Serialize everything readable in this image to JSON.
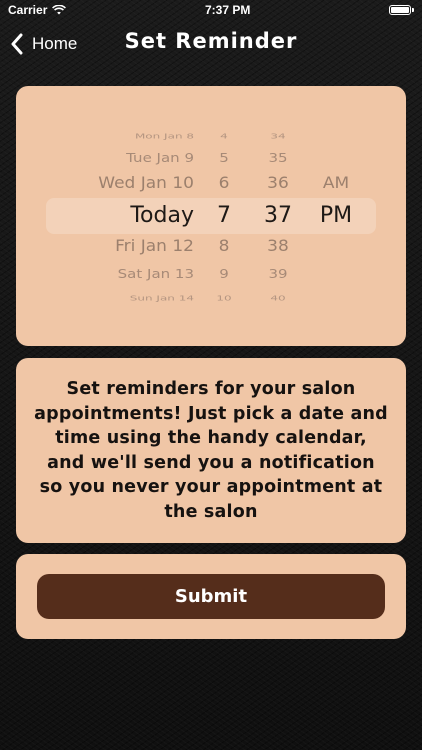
{
  "status_bar": {
    "carrier": "Carrier",
    "time": "7:37 PM"
  },
  "nav": {
    "back_label": "Home",
    "title": "Set Reminder"
  },
  "picker": {
    "rows": [
      {
        "date": "Mon Jan 8",
        "hour": "4",
        "minute": "34",
        "ampm": ""
      },
      {
        "date": "Tue Jan 9",
        "hour": "5",
        "minute": "35",
        "ampm": ""
      },
      {
        "date": "Wed Jan 10",
        "hour": "6",
        "minute": "36",
        "ampm": "AM"
      },
      {
        "date": "Today",
        "hour": "7",
        "minute": "37",
        "ampm": "PM"
      },
      {
        "date": "Fri Jan 12",
        "hour": "8",
        "minute": "38",
        "ampm": ""
      },
      {
        "date": "Sat Jan 13",
        "hour": "9",
        "minute": "39",
        "ampm": ""
      },
      {
        "date": "Sun Jan 14",
        "hour": "10",
        "minute": "40",
        "ampm": ""
      }
    ],
    "selected": {
      "date": "Today",
      "hour": "7",
      "minute": "37",
      "ampm": "PM"
    }
  },
  "info": {
    "text": "Set reminders for your salon appointments! Just pick a date and time using the handy calendar, and we'll send you a notification so you never your appointment at the salon"
  },
  "submit": {
    "label": "Submit"
  },
  "colors": {
    "card": "#f0c6a6",
    "button": "#552d1b",
    "background": "#141414",
    "text": "#161210"
  }
}
